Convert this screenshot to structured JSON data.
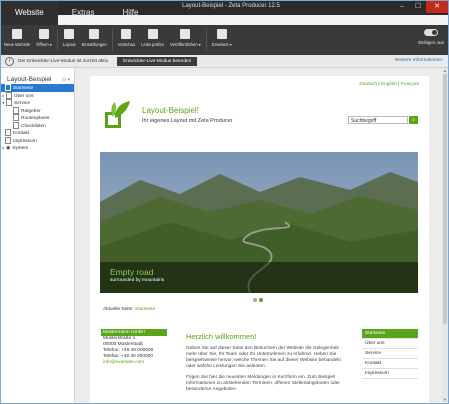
{
  "window": {
    "title": "Layout-Beispiel - Zeta Producer 12.5"
  },
  "tabs": [
    {
      "label": "Website"
    },
    {
      "label": "Extras"
    },
    {
      "label": "Hilfe"
    }
  ],
  "ribbon": {
    "new_website": "Neue Website",
    "open": "Öffnen ▾",
    "layout": "Layout",
    "settings": "Einstellungen",
    "preview": "Vorschau",
    "check_links": "Links prüfen",
    "publish": "Veröffentlichen ▾",
    "advanced": "Erweitert ▾",
    "paste_toggle": "Einfügen: aus"
  },
  "infobar": {
    "text": "Der Entwickler-Live-Modus ist zurzeit aktiv.",
    "button": "Entwickler-Live-Modus beenden",
    "link": "Weitere Informationen"
  },
  "sidebar": {
    "title": "Layout-Beispiel",
    "items": [
      {
        "label": "Startseite"
      },
      {
        "label": "Über uns"
      },
      {
        "label": "Service"
      },
      {
        "label": "Ratgeber"
      },
      {
        "label": "Routenplaner"
      },
      {
        "label": "Checklisten"
      },
      {
        "label": "Kontakt"
      },
      {
        "label": "Impressum"
      },
      {
        "label": "System"
      }
    ]
  },
  "site": {
    "lang": {
      "de": "Deutsch",
      "en": "English",
      "fr": "Français"
    },
    "title": "Layout-Beispiel!",
    "subtitle": "Ihr eigenes Layout mit Zeta Producer",
    "search_placeholder": "Suchbegriff",
    "hero_caption": "Empty road",
    "hero_sub": "surrounded by mountains",
    "crumb_label": "Aktuelle Seite:",
    "crumb_link": "Startseite",
    "address": {
      "name": "Mustermann GmbH",
      "street": "Musterstraße 1",
      "city": "00000 Musterstadt",
      "phone": "Telefon: +49 40 000000",
      "fax": "Telefax: +49 40 000000",
      "email": "info@example.com"
    },
    "welcome_title": "Herzlich willkommen!",
    "welcome_p1": "Geben Sie auf dieser Seite den Besuchern der Website die Gelegenheit mehr über Sie, Ihr Team oder Ihr Unternehmen zu erfahren. Heben Sie beispielsweise hervor, welche Themen Sie auf dieser Website behandeln oder welche Leistungen Sie anbieten.",
    "welcome_p2": "Fügen Sie hier die neuesten Meldungen in Kurzform ein. Zum Beispiel Informationen zu anstehenden Terminen, offenen Stellenangeboten oder besonderen Angeboten.",
    "right_nav": [
      {
        "label": "Startseite"
      },
      {
        "label": "Über uns"
      },
      {
        "label": "Service"
      },
      {
        "label": "Kontakt"
      },
      {
        "label": "Impressum"
      }
    ]
  },
  "colors": {
    "accent": "#5aa519",
    "selection": "#2a79d0",
    "ribbon": "#3a3a3a"
  }
}
